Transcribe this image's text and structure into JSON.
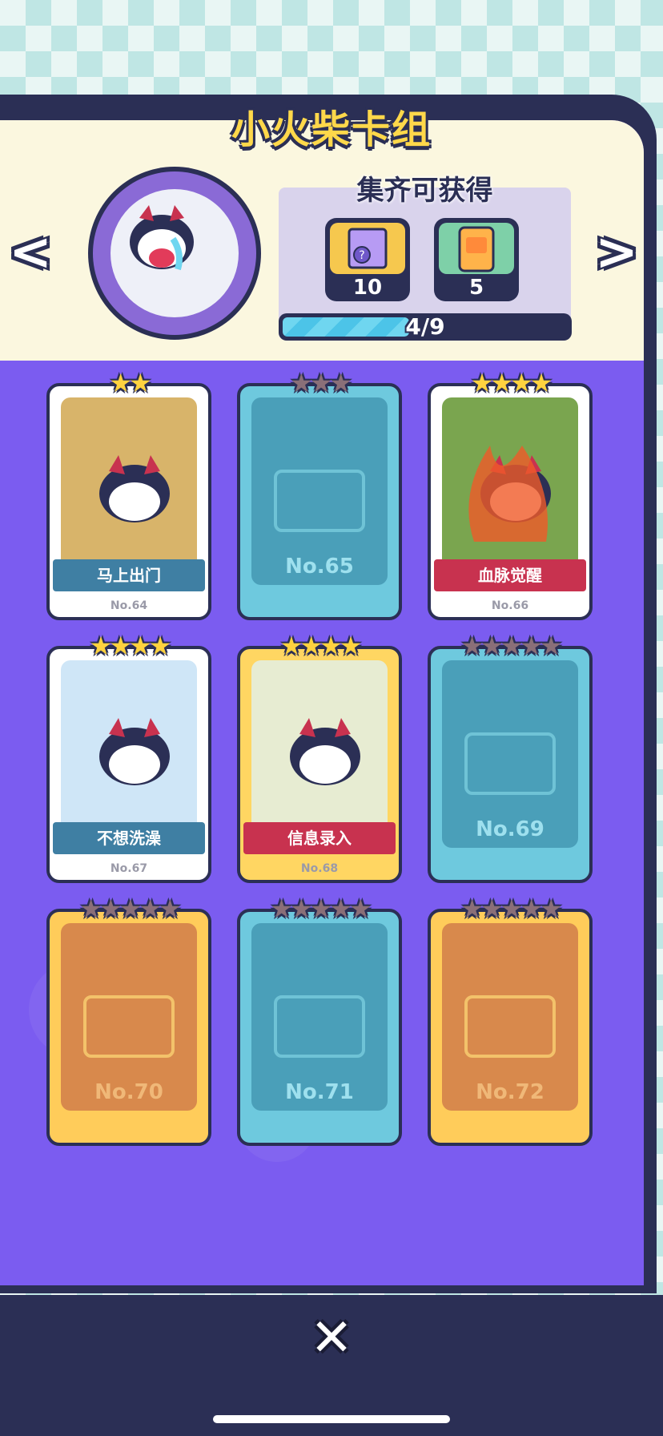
{
  "header": {
    "title": "小火柴卡组"
  },
  "nav": {
    "prev": "<",
    "next": ">"
  },
  "reward": {
    "title": "集齐可获得",
    "items": [
      {
        "icon": "mystery-box-icon",
        "count": "10"
      },
      {
        "icon": "card-pack-icon",
        "count": "5"
      }
    ],
    "progress": {
      "label": "4/9",
      "value": 0.444
    }
  },
  "cards": [
    {
      "stars": 2,
      "owned": true,
      "title": "马上出门",
      "number": "No.64"
    },
    {
      "stars": 3,
      "owned": false,
      "number": "No.65"
    },
    {
      "stars": 4,
      "owned": true,
      "title": "血脉觉醒",
      "number": "No.66"
    },
    {
      "stars": 4,
      "owned": true,
      "title": "不想洗澡",
      "number": "No.67"
    },
    {
      "stars": 4,
      "owned": true,
      "title": "信息录入",
      "number": "No.68"
    },
    {
      "stars": 5,
      "owned": false,
      "number": "No.69"
    },
    {
      "stars": 5,
      "owned": false,
      "number": "No.70"
    },
    {
      "stars": 5,
      "owned": false,
      "number": "No.71"
    },
    {
      "stars": 5,
      "owned": false,
      "number": "No.72"
    }
  ],
  "colors": {
    "accent": "#7b5cf0",
    "title": "#ffd84a",
    "outline": "#2b2f55"
  },
  "footer": {
    "close": "✕"
  }
}
